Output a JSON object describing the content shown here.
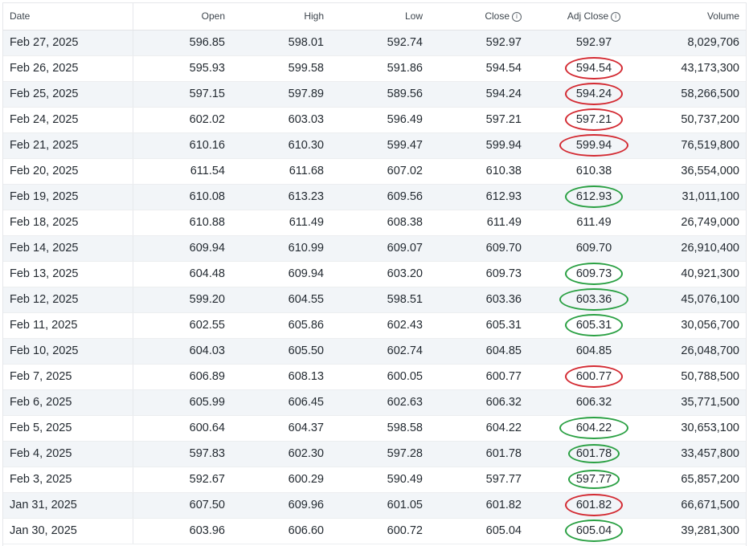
{
  "columns": {
    "date": "Date",
    "open": "Open",
    "high": "High",
    "low": "Low",
    "close": "Close",
    "adj_close": "Adj Close",
    "volume": "Volume"
  },
  "info_icon": "info-icon",
  "marker_colors": {
    "red": "#d32a32",
    "green": "#2aa043"
  },
  "rows": [
    {
      "date": "Feb 27, 2025",
      "open": "596.85",
      "high": "598.01",
      "low": "592.74",
      "close": "592.97",
      "adj_close": "592.97",
      "volume": "8,029,706",
      "mark": ""
    },
    {
      "date": "Feb 26, 2025",
      "open": "595.93",
      "high": "599.58",
      "low": "591.86",
      "close": "594.54",
      "adj_close": "594.54",
      "volume": "43,173,300",
      "mark": "red"
    },
    {
      "date": "Feb 25, 2025",
      "open": "597.15",
      "high": "597.89",
      "low": "589.56",
      "close": "594.24",
      "adj_close": "594.24",
      "volume": "58,266,500",
      "mark": "red"
    },
    {
      "date": "Feb 24, 2025",
      "open": "602.02",
      "high": "603.03",
      "low": "596.49",
      "close": "597.21",
      "adj_close": "597.21",
      "volume": "50,737,200",
      "mark": "red"
    },
    {
      "date": "Feb 21, 2025",
      "open": "610.16",
      "high": "610.30",
      "low": "599.47",
      "close": "599.94",
      "adj_close": "599.94",
      "volume": "76,519,800",
      "mark": "red"
    },
    {
      "date": "Feb 20, 2025",
      "open": "611.54",
      "high": "611.68",
      "low": "607.02",
      "close": "610.38",
      "adj_close": "610.38",
      "volume": "36,554,000",
      "mark": ""
    },
    {
      "date": "Feb 19, 2025",
      "open": "610.08",
      "high": "613.23",
      "low": "609.56",
      "close": "612.93",
      "adj_close": "612.93",
      "volume": "31,011,100",
      "mark": "green"
    },
    {
      "date": "Feb 18, 2025",
      "open": "610.88",
      "high": "611.49",
      "low": "608.38",
      "close": "611.49",
      "adj_close": "611.49",
      "volume": "26,749,000",
      "mark": ""
    },
    {
      "date": "Feb 14, 2025",
      "open": "609.94",
      "high": "610.99",
      "low": "609.07",
      "close": "609.70",
      "adj_close": "609.70",
      "volume": "26,910,400",
      "mark": ""
    },
    {
      "date": "Feb 13, 2025",
      "open": "604.48",
      "high": "609.94",
      "low": "603.20",
      "close": "609.73",
      "adj_close": "609.73",
      "volume": "40,921,300",
      "mark": "green"
    },
    {
      "date": "Feb 12, 2025",
      "open": "599.20",
      "high": "604.55",
      "low": "598.51",
      "close": "603.36",
      "adj_close": "603.36",
      "volume": "45,076,100",
      "mark": "green"
    },
    {
      "date": "Feb 11, 2025",
      "open": "602.55",
      "high": "605.86",
      "low": "602.43",
      "close": "605.31",
      "adj_close": "605.31",
      "volume": "30,056,700",
      "mark": "green"
    },
    {
      "date": "Feb 10, 2025",
      "open": "604.03",
      "high": "605.50",
      "low": "602.74",
      "close": "604.85",
      "adj_close": "604.85",
      "volume": "26,048,700",
      "mark": ""
    },
    {
      "date": "Feb 7, 2025",
      "open": "606.89",
      "high": "608.13",
      "low": "600.05",
      "close": "600.77",
      "adj_close": "600.77",
      "volume": "50,788,500",
      "mark": "red"
    },
    {
      "date": "Feb 6, 2025",
      "open": "605.99",
      "high": "606.45",
      "low": "602.63",
      "close": "606.32",
      "adj_close": "606.32",
      "volume": "35,771,500",
      "mark": ""
    },
    {
      "date": "Feb 5, 2025",
      "open": "600.64",
      "high": "604.37",
      "low": "598.58",
      "close": "604.22",
      "adj_close": "604.22",
      "volume": "30,653,100",
      "mark": "green"
    },
    {
      "date": "Feb 4, 2025",
      "open": "597.83",
      "high": "602.30",
      "low": "597.28",
      "close": "601.78",
      "adj_close": "601.78",
      "volume": "33,457,800",
      "mark": "green"
    },
    {
      "date": "Feb 3, 2025",
      "open": "592.67",
      "high": "600.29",
      "low": "590.49",
      "close": "597.77",
      "adj_close": "597.77",
      "volume": "65,857,200",
      "mark": "green"
    },
    {
      "date": "Jan 31, 2025",
      "open": "607.50",
      "high": "609.96",
      "low": "601.05",
      "close": "601.82",
      "adj_close": "601.82",
      "volume": "66,671,500",
      "mark": "red"
    },
    {
      "date": "Jan 30, 2025",
      "open": "603.96",
      "high": "606.60",
      "low": "600.72",
      "close": "605.04",
      "adj_close": "605.04",
      "volume": "39,281,300",
      "mark": "green"
    }
  ]
}
